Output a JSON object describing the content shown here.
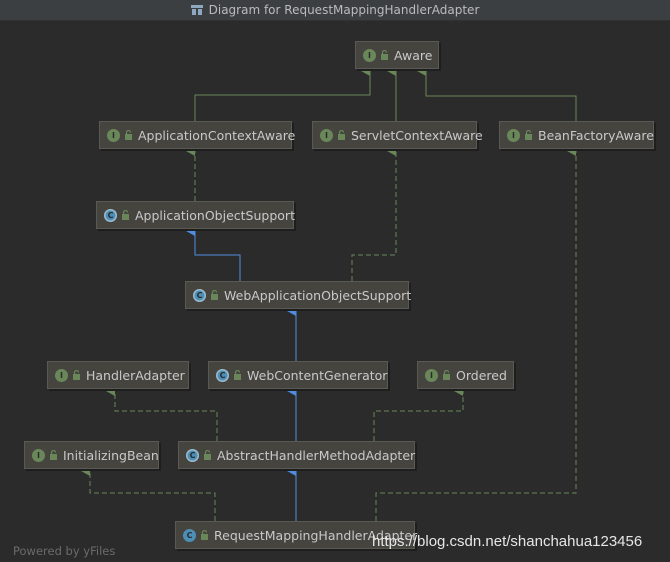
{
  "window": {
    "title": "Diagram for RequestMappingHandlerAdapter"
  },
  "nodes": {
    "aware": {
      "label": "Aware",
      "kind": "I"
    },
    "application_context_aware": {
      "label": "ApplicationContextAware",
      "kind": "I"
    },
    "servlet_context_aware": {
      "label": "ServletContextAware",
      "kind": "I"
    },
    "bean_factory_aware": {
      "label": "BeanFactoryAware",
      "kind": "I"
    },
    "application_object_support": {
      "label": "ApplicationObjectSupport",
      "kind": "C"
    },
    "web_application_object_support": {
      "label": "WebApplicationObjectSupport",
      "kind": "C"
    },
    "handler_adapter": {
      "label": "HandlerAdapter",
      "kind": "I"
    },
    "web_content_generator": {
      "label": "WebContentGenerator",
      "kind": "C"
    },
    "ordered": {
      "label": "Ordered",
      "kind": "I"
    },
    "initializing_bean": {
      "label": "InitializingBean",
      "kind": "I"
    },
    "abstract_handler_method_adapter": {
      "label": "AbstractHandlerMethodAdapter",
      "kind": "C"
    },
    "request_mapping_handler_adapter": {
      "label": "RequestMappingHandlerAdapter",
      "kind": "C"
    }
  },
  "footer": {
    "powered_by": "Powered by yFiles",
    "watermark": "https://blog.csdn.net/shanchahua123456"
  },
  "colors": {
    "implements_edge": "#6a8759",
    "extends_edge": "#4f8de0",
    "interface_badge": "#6a8759",
    "class_badge": "#4c8fb6"
  }
}
